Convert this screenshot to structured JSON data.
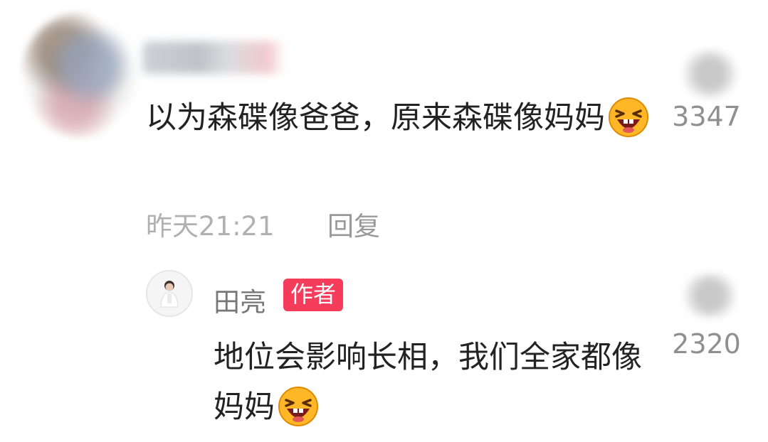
{
  "comment": {
    "username": "",
    "text": "以为森碟像爸爸，原来森碟像妈妈",
    "emoji": "laughing-emoji",
    "time": "昨天21:21",
    "reply_label": "回复",
    "likes": "3347"
  },
  "reply": {
    "username": "田亮",
    "badge": "作者",
    "text": "地位会影响长相，我们全家都像妈妈",
    "emoji": "laughing-emoji",
    "likes": "2320"
  },
  "colors": {
    "badge_bg": "#f53d5b",
    "meta_text": "#b0b0b0",
    "like_count": "#8f8f8f"
  }
}
